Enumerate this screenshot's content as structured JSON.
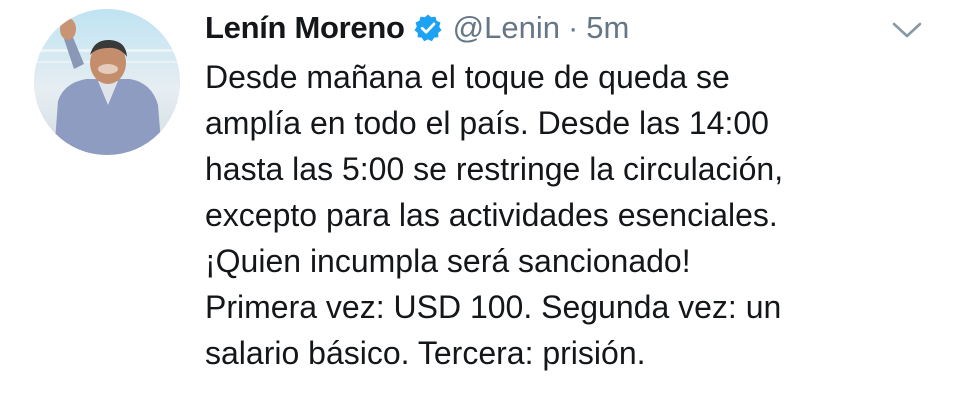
{
  "tweet": {
    "author": {
      "name": "Lenín Moreno",
      "handle": "@Lenin",
      "separator": "·",
      "time": "5m"
    },
    "text_lines": [
      "Desde mañana el toque de queda se",
      "amplía en todo el país. Desde las 14:00",
      "hasta las 5:00 se restringe la circulación,",
      "excepto para las actividades esenciales.",
      "¡Quien incumpla será sancionado!",
      "Primera vez: USD 100. Segunda vez: un",
      "salario básico. Tercera: prisión."
    ]
  },
  "icons": {
    "verified": "verified-badge-icon",
    "more": "chevron-down-icon"
  },
  "colors": {
    "verified_blue": "#1da1f2",
    "secondary_text": "#657786",
    "primary_text": "#14171a"
  }
}
